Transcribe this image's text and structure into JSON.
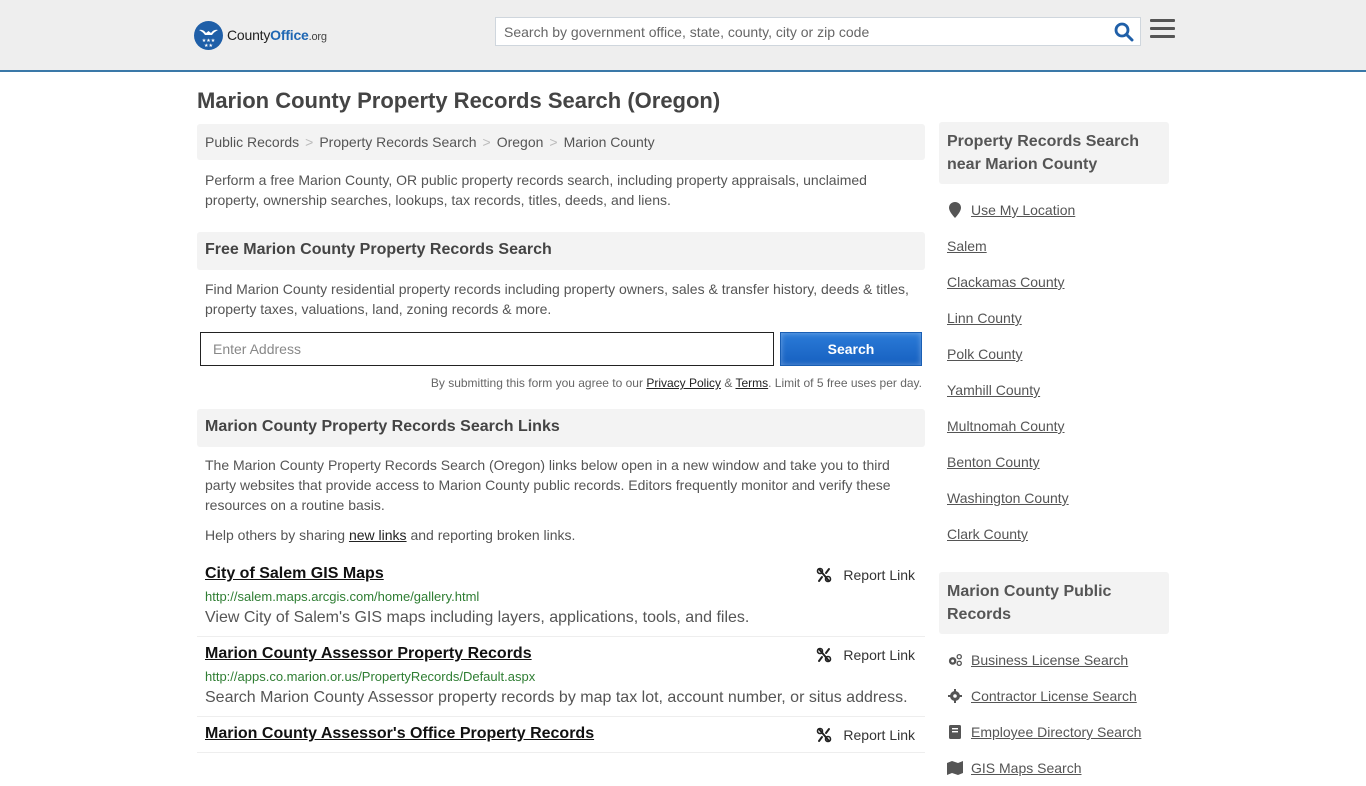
{
  "header": {
    "logo": {
      "name": "County",
      "accent": "Office",
      "tld": ".org"
    },
    "search_placeholder": "Search by government office, state, county, city or zip code",
    "colors": {
      "brand_blue": "#1f67b3",
      "header_bg": "#eeeeee",
      "header_border": "#3a78a8"
    }
  },
  "page_title": "Marion County Property Records Search (Oregon)",
  "breadcrumb": [
    {
      "label": "Public Records"
    },
    {
      "label": "Property Records Search"
    },
    {
      "label": "Oregon"
    },
    {
      "label": "Marion County"
    }
  ],
  "breadcrumb_sep": ">",
  "intro": "Perform a free Marion County, OR public property records search, including property appraisals, unclaimed property, ownership searches, lookups, tax records, titles, deeds, and liens.",
  "free_search": {
    "heading": "Free Marion County Property Records Search",
    "description": "Find Marion County residential property records including property owners, sales & transfer history, deeds & titles, property taxes, valuations, land, zoning records & more.",
    "address_placeholder": "Enter Address",
    "button_label": "Search",
    "disclaimer_pre": "By submitting this form you agree to our ",
    "privacy_label": "Privacy Policy",
    "amp": " & ",
    "terms_label": "Terms",
    "disclaimer_post": ". Limit of 5 free uses per day."
  },
  "links_section": {
    "heading": "Marion County Property Records Search Links",
    "description": "The Marion County Property Records Search (Oregon) links below open in a new window and take you to third party websites that provide access to Marion County public records. Editors frequently monitor and verify these resources on a routine basis.",
    "help_pre": "Help others by sharing ",
    "help_link": "new links",
    "help_post": " and reporting broken links.",
    "report_label": "Report Link",
    "items": [
      {
        "title": "City of Salem GIS Maps",
        "url": "http://salem.maps.arcgis.com/home/gallery.html",
        "desc": "View City of Salem's GIS maps including layers, applications, tools, and files."
      },
      {
        "title": "Marion County Assessor Property Records",
        "url": "http://apps.co.marion.or.us/PropertyRecords/Default.aspx",
        "desc": "Search Marion County Assessor property records by map tax lot, account number, or situs address."
      },
      {
        "title": "Marion County Assessor's Office Property Records",
        "url": "",
        "desc": ""
      }
    ]
  },
  "sidebar": {
    "nearby_heading": "Property Records Search near Marion County",
    "use_location": "Use My Location",
    "nearby": [
      "Salem",
      "Clackamas County",
      "Linn County",
      "Polk County",
      "Yamhill County",
      "Multnomah County",
      "Benton County",
      "Washington County",
      "Clark County"
    ],
    "public_heading": "Marion County Public Records",
    "public_links": [
      {
        "label": "Business License Search",
        "icon": "cogs-icon"
      },
      {
        "label": "Contractor License Search",
        "icon": "gear-icon"
      },
      {
        "label": "Employee Directory Search",
        "icon": "book-icon"
      },
      {
        "label": "GIS Maps Search",
        "icon": "map-icon"
      }
    ]
  }
}
